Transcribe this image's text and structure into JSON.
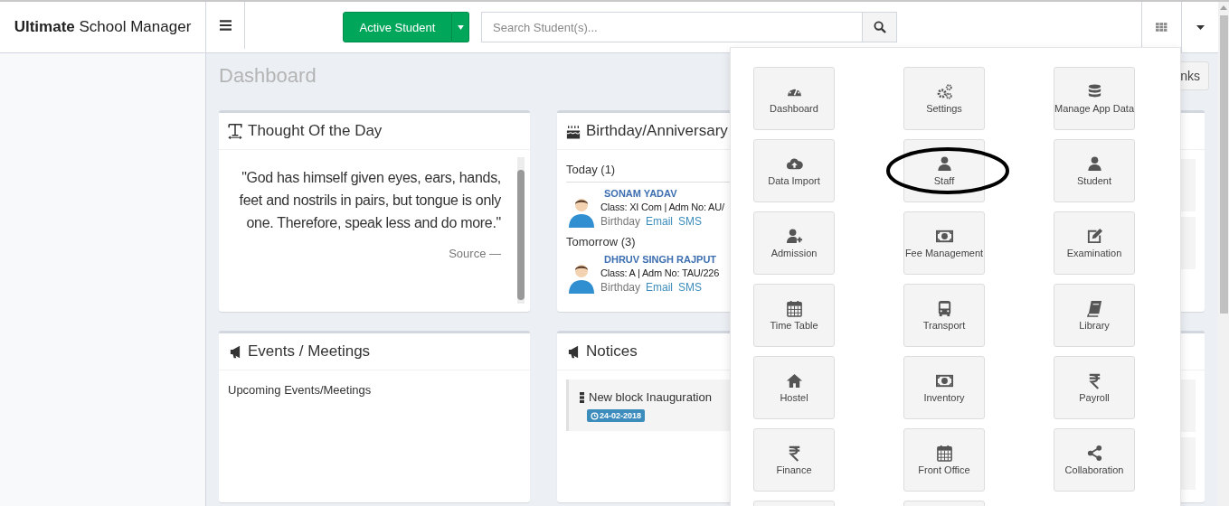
{
  "header": {
    "brand": "**Ultimate** School Manager",
    "active_button": "Active Student",
    "search": {
      "placeholder": "Search Student(s)..."
    }
  },
  "page_title": "Dashboard",
  "links_button": "nks",
  "cards": [
    {
      "kind": "thought",
      "title": "Thought Of the Day",
      "quote": "\"God has himself given eyes, ears, hands, feet and nostrils in pairs, but tongue is only one. Therefore, speak less and do more.\"",
      "source": "Source —"
    },
    {
      "kind": "birthday",
      "title": "Birthday/Anniversary",
      "groups": [
        {
          "heading": "Today (1)",
          "people": [
            {
              "name": "SONAM YADAV",
              "details": "Class: XI Com | Adm No: AU/",
              "occasion": "Birthday",
              "links": [
                "Email",
                "SMS"
              ]
            }
          ]
        },
        {
          "heading": "Tomorrow (3)",
          "people": [
            {
              "name": "DHRUV SINGH RAJPUT",
              "details": "Class: A | Adm No: TAU/226",
              "occasion": "Birthday",
              "links": [
                "Email",
                "SMS"
              ]
            }
          ]
        }
      ]
    },
    {
      "kind": "covered"
    },
    {
      "kind": "events",
      "title": "Events / Meetings",
      "subtitle": "Upcoming Events/Meetings"
    },
    {
      "kind": "notices",
      "title": "Notices",
      "items": [
        {
          "title": "New block Inauguration",
          "date": "24-02-2018"
        }
      ]
    },
    {
      "kind": "covered"
    }
  ],
  "menu_tiles": [
    {
      "kind": "tile",
      "label": "Dashboard",
      "circled": false
    },
    {
      "kind": "tile",
      "label": "Settings",
      "circled": false
    },
    {
      "kind": "tile",
      "label": "Manage App Data",
      "circled": false
    },
    {
      "kind": "tile",
      "label": "Data Import",
      "circled": false
    },
    {
      "kind": "tile",
      "label": "Staff",
      "circled": true
    },
    {
      "kind": "tile",
      "label": "Student",
      "circled": false
    },
    {
      "kind": "tile",
      "label": "Admission",
      "circled": false
    },
    {
      "kind": "tile",
      "label": "Fee Management",
      "circled": false
    },
    {
      "kind": "tile",
      "label": "Examination",
      "circled": false
    },
    {
      "kind": "tile",
      "label": "Time Table",
      "circled": false
    },
    {
      "kind": "tile",
      "label": "Transport",
      "circled": false
    },
    {
      "kind": "tile",
      "label": "Library",
      "circled": false
    },
    {
      "kind": "tile",
      "label": "Hostel",
      "circled": false
    },
    {
      "kind": "tile",
      "label": "Inventory",
      "circled": false
    },
    {
      "kind": "tile",
      "label": "Payroll",
      "circled": false
    },
    {
      "kind": "tile",
      "label": "Finance",
      "circled": false
    },
    {
      "kind": "tile",
      "label": "Front Office",
      "circled": false
    },
    {
      "kind": "tile",
      "label": "Collaboration",
      "circled": false
    },
    {
      "kind": "cut"
    },
    {
      "kind": "cut"
    }
  ]
}
